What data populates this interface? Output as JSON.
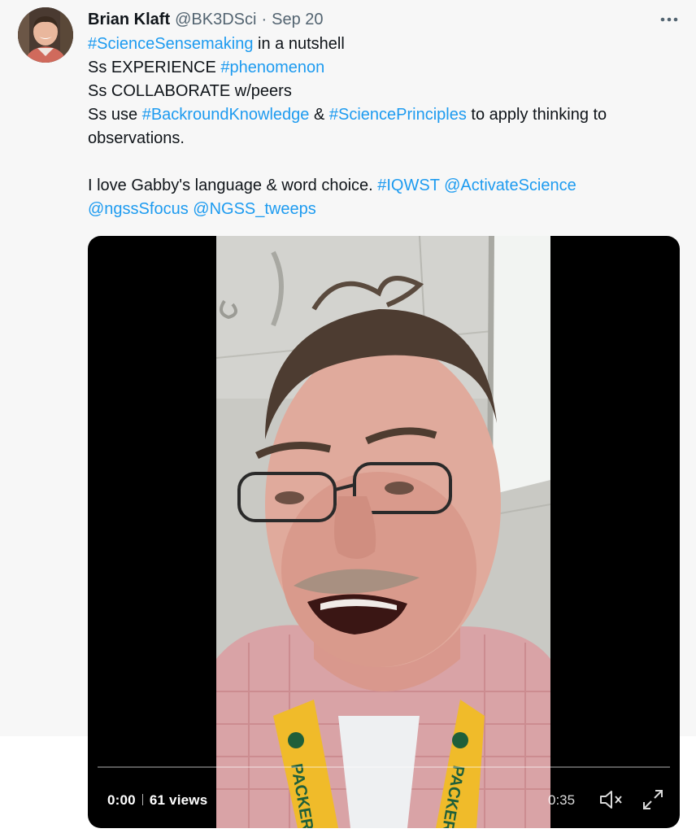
{
  "tweet": {
    "author_name": "Brian Klaft",
    "handle": "@BK3DSci",
    "separator": "·",
    "date": "Sep 20",
    "more_icon": "more-horizontal-icon",
    "lines": [
      [
        {
          "t": "#ScienceSensemaking",
          "tag": true
        },
        {
          "t": " in a nutshell",
          "tag": false
        }
      ],
      [
        {
          "t": "Ss EXPERIENCE ",
          "tag": false
        },
        {
          "t": "#phenomenon",
          "tag": true
        }
      ],
      [
        {
          "t": "Ss COLLABORATE w/peers",
          "tag": false
        }
      ],
      [
        {
          "t": "Ss use ",
          "tag": false
        },
        {
          "t": "#BackroundKnowledge",
          "tag": true
        },
        {
          "t": " & ",
          "tag": false
        },
        {
          "t": "#SciencePrinciples",
          "tag": true
        },
        {
          "t": " to apply thinking to",
          "tag": false
        }
      ],
      [
        {
          "t": "observations.",
          "tag": false
        }
      ],
      [],
      [
        {
          "t": "I love Gabby's language & word choice. ",
          "tag": false
        },
        {
          "t": "#IQWST",
          "tag": true
        },
        {
          "t": " ",
          "tag": false
        },
        {
          "t": "@ActivateScience",
          "tag": true
        }
      ],
      [
        {
          "t": "@ngssSfocus",
          "tag": true
        },
        {
          "t": " ",
          "tag": false
        },
        {
          "t": "@NGSS_tweeps",
          "tag": true
        }
      ]
    ],
    "colors": {
      "link": "#1d9bf0",
      "text": "#0f1419",
      "muted": "#536471"
    }
  },
  "video": {
    "current_time": "0:00",
    "views": "61 views",
    "remaining_time": "0:35",
    "progress": 0,
    "mute_icon": "volume-muted-icon",
    "fullscreen_icon": "fullscreen-expand-icon",
    "lanyard_text": "PACKERS"
  }
}
